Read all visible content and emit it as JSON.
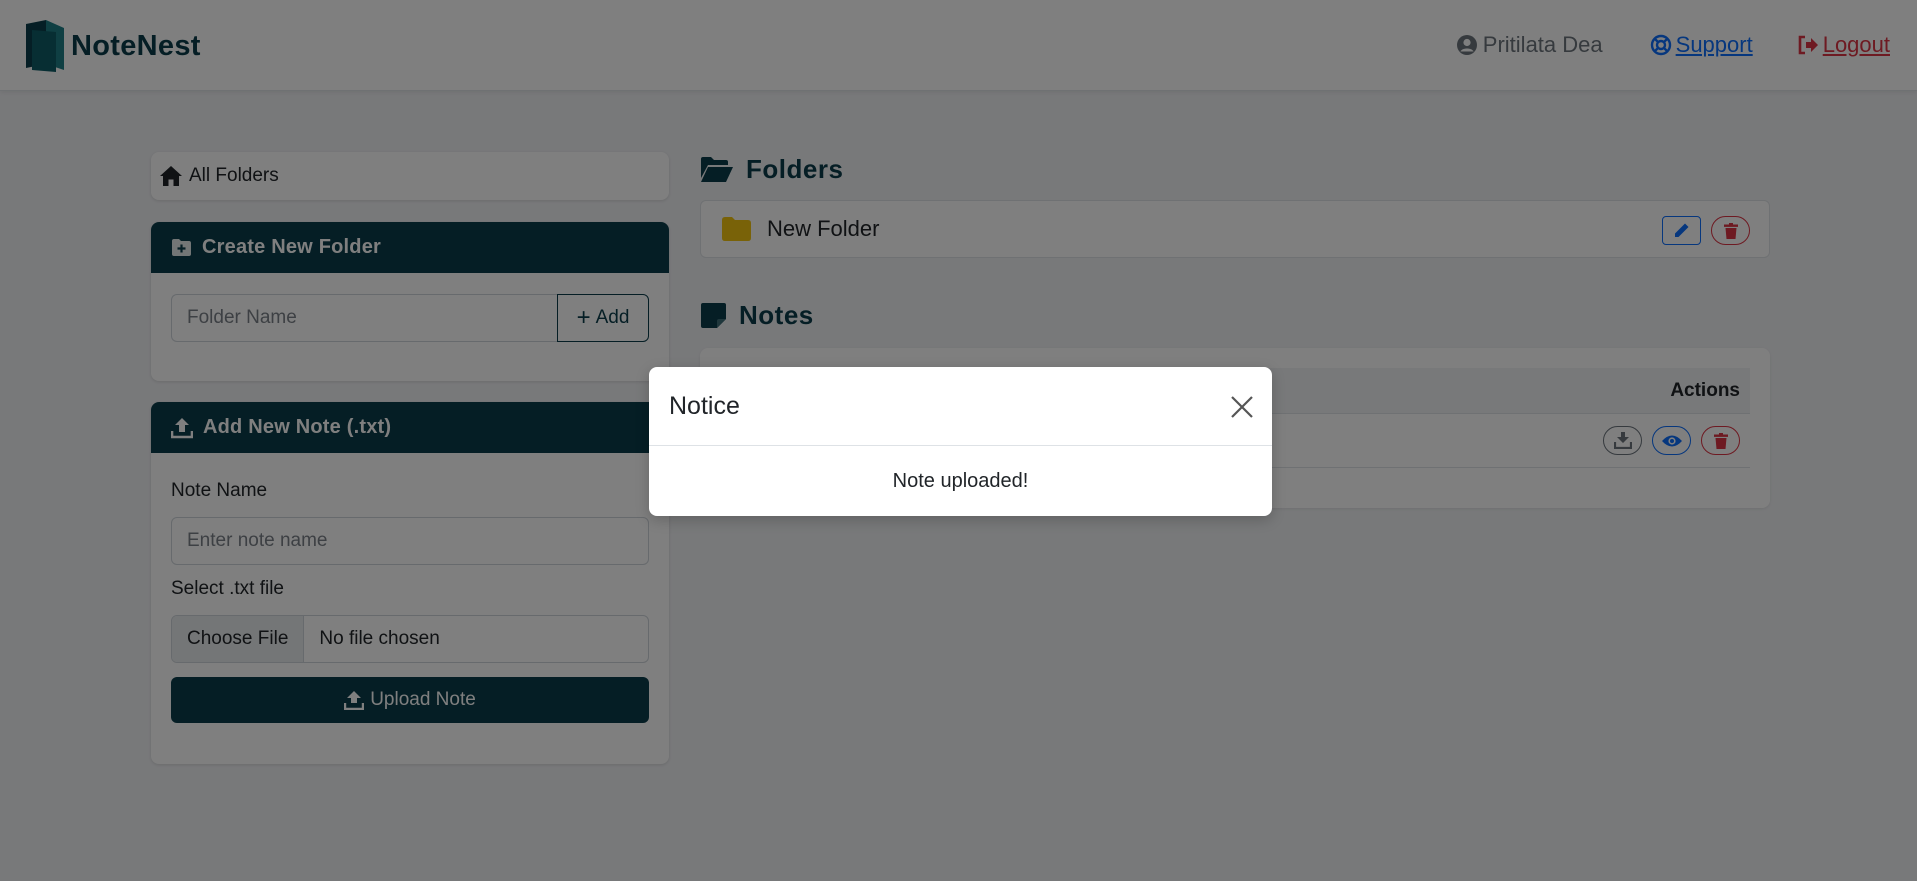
{
  "navbar": {
    "brand": "NoteNest",
    "user": "Pritilata Dea",
    "support": "Support",
    "logout": "Logout"
  },
  "sidebar": {
    "all_folders": "All Folders",
    "create_folder": {
      "title": "Create New Folder",
      "placeholder": "Folder Name",
      "add_label": "Add"
    },
    "add_note": {
      "title": "Add New Note (.txt)",
      "note_name_label": "Note Name",
      "note_name_placeholder": "Enter note name",
      "file_label": "Select .txt file",
      "choose_file": "Choose File",
      "file_status": "No file chosen",
      "upload_label": "Upload Note"
    }
  },
  "main": {
    "folders_title": "Folders",
    "folders": [
      {
        "name": "New Folder"
      }
    ],
    "notes_title": "Notes",
    "notes_actions_header": "Actions"
  },
  "modal": {
    "title": "Notice",
    "message": "Note uploaded!"
  },
  "colors": {
    "brand": "#0b3d4a",
    "link": "#0d6efd",
    "danger": "#dc3545",
    "folder": "#f2c410"
  }
}
